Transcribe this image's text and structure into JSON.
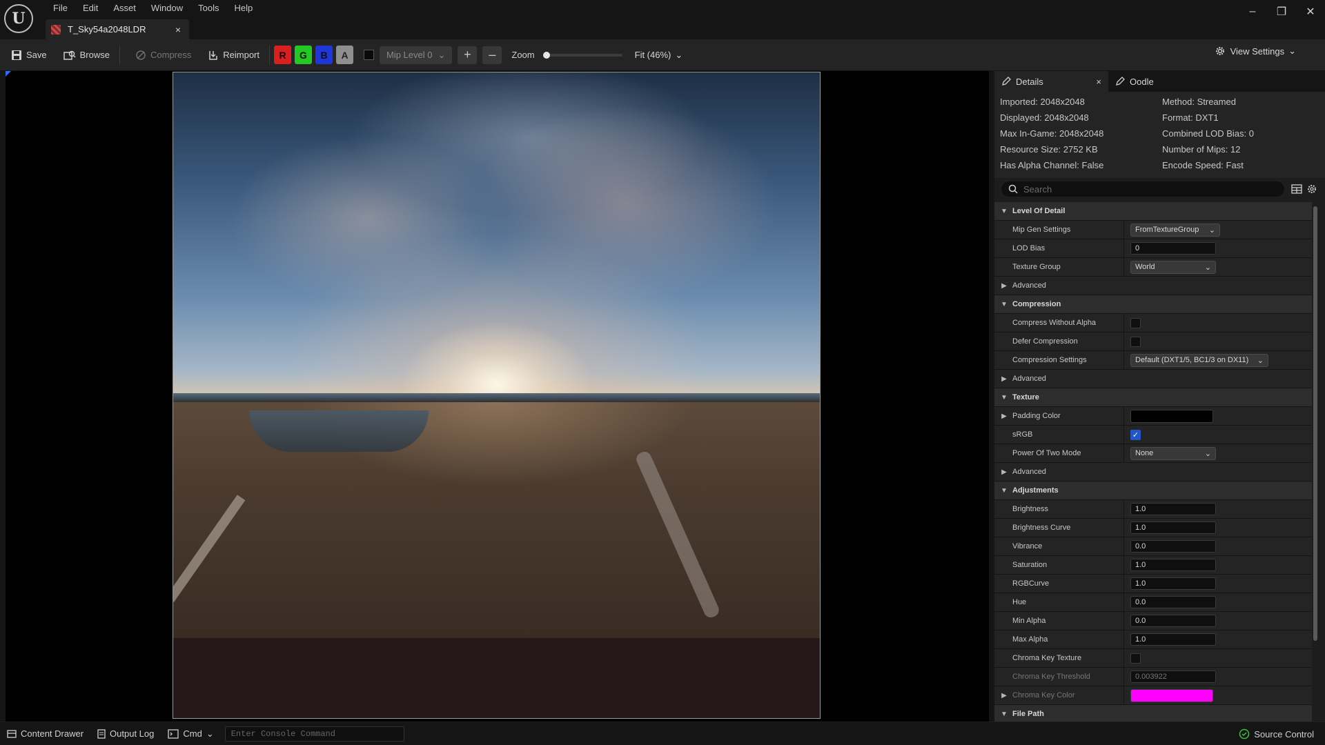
{
  "menu": [
    "File",
    "Edit",
    "Asset",
    "Window",
    "Tools",
    "Help"
  ],
  "document_tab": {
    "label": "T_Sky54a2048LDR",
    "close": "×"
  },
  "window_controls": {
    "minimize": "–",
    "restore": "❐",
    "close": "✕"
  },
  "toolbar": {
    "save": "Save",
    "browse": "Browse",
    "compress": "Compress",
    "reimport": "Reimport",
    "channels": {
      "r": "R",
      "g": "G",
      "b": "B",
      "a": "A"
    },
    "mip_level": "Mip Level 0",
    "zoom_label": "Zoom",
    "zoom_level": 0.0,
    "zoom_fit": "Fit (46%)",
    "view_settings": "View Settings"
  },
  "details_panel": {
    "tabs": {
      "details": "Details",
      "close": "×",
      "oodle": "Oodle"
    },
    "texture_info": {
      "imported": "Imported: 2048x2048",
      "displayed": "Displayed: 2048x2048",
      "max_in_game": "Max In-Game: 2048x2048",
      "resource_size": "Resource Size: 2752 KB",
      "has_alpha": "Has Alpha Channel: False",
      "method": "Method: Streamed",
      "format": "Format: DXT1",
      "combined_lod_bias": "Combined LOD Bias: 0",
      "num_mips": "Number of Mips: 12",
      "encode_speed": "Encode Speed: Fast"
    },
    "search": {
      "placeholder": "Search"
    },
    "sections": {
      "lod": {
        "title": "Level Of Detail",
        "mip_gen_settings": {
          "label": "Mip Gen Settings",
          "value": "FromTextureGroup"
        },
        "lod_bias": {
          "label": "LOD Bias",
          "value": "0"
        },
        "texture_group": {
          "label": "Texture Group",
          "value": "World"
        },
        "advanced": "Advanced"
      },
      "compression": {
        "title": "Compression",
        "compress_without_alpha": {
          "label": "Compress Without Alpha",
          "checked": false
        },
        "defer_compression": {
          "label": "Defer Compression",
          "checked": false
        },
        "compression_settings": {
          "label": "Compression Settings",
          "value": "Default (DXT1/5, BC1/3 on DX11)"
        },
        "advanced": "Advanced"
      },
      "texture": {
        "title": "Texture",
        "padding_color": {
          "label": "Padding Color",
          "color": "#000000"
        },
        "srgb": {
          "label": "sRGB",
          "checked": true,
          "mark": "✓"
        },
        "power_of_two": {
          "label": "Power Of Two Mode",
          "value": "None"
        },
        "advanced": "Advanced"
      },
      "adjustments": {
        "title": "Adjustments",
        "brightness": {
          "label": "Brightness",
          "value": "1.0"
        },
        "brightness_curve": {
          "label": "Brightness Curve",
          "value": "1.0"
        },
        "vibrance": {
          "label": "Vibrance",
          "value": "0.0"
        },
        "saturation": {
          "label": "Saturation",
          "value": "1.0"
        },
        "rgb_curve": {
          "label": "RGBCurve",
          "value": "1.0"
        },
        "hue": {
          "label": "Hue",
          "value": "0.0"
        },
        "min_alpha": {
          "label": "Min Alpha",
          "value": "0.0"
        },
        "max_alpha": {
          "label": "Max Alpha",
          "value": "1.0"
        },
        "chroma_key_texture": {
          "label": "Chroma Key Texture",
          "checked": false
        },
        "chroma_key_threshold": {
          "label": "Chroma Key Threshold",
          "value": "0.003922"
        },
        "chroma_key_color": {
          "label": "Chroma Key Color",
          "color": "#ff00ff"
        }
      },
      "file_path": {
        "title": "File Path"
      }
    }
  },
  "statusbar": {
    "content_drawer": "Content Drawer",
    "output_log": "Output Log",
    "cmd": "Cmd",
    "console_placeholder": "Enter Console Command",
    "source_control": "Source Control"
  }
}
